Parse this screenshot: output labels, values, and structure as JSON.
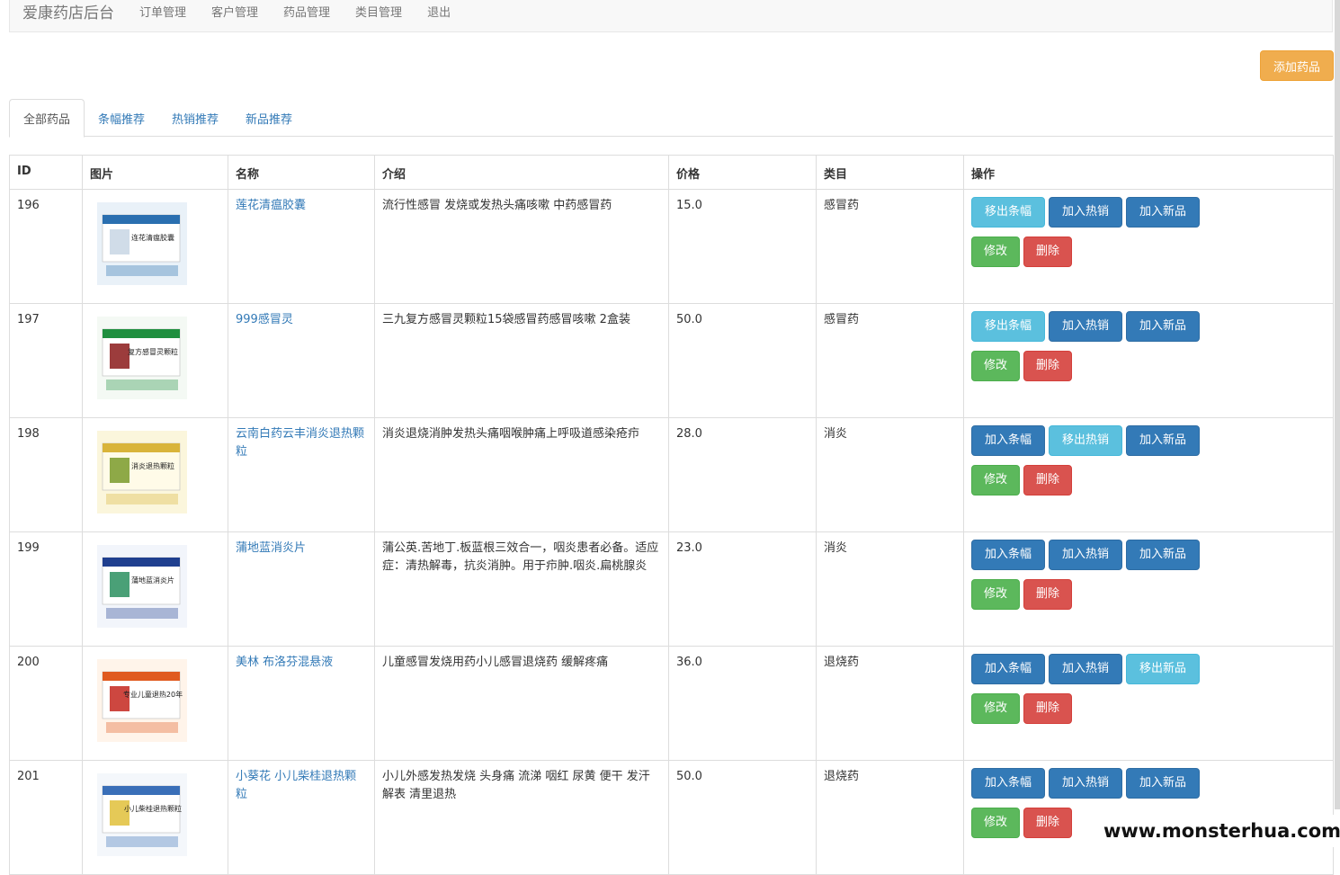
{
  "navbar": {
    "brand": "爱康药店后台",
    "links": [
      "订单管理",
      "客户管理",
      "药品管理",
      "类目管理",
      "退出"
    ]
  },
  "add_button": "添加药品",
  "tabs": [
    "全部药品",
    "条幅推荐",
    "热销推荐",
    "新品推荐"
  ],
  "table": {
    "headers": [
      "ID",
      "图片",
      "名称",
      "介绍",
      "价格",
      "类目",
      "操作"
    ],
    "rows": [
      {
        "id": "196",
        "name": "莲花清瘟胶囊",
        "desc": "流行性感冒 发烧或发热头痛咳嗽 中药感冒药",
        "price": "15.0",
        "category": "感冒药",
        "ops": [
          "移出条幅",
          "加入热销",
          "加入新品",
          "修改",
          "删除"
        ],
        "op_styles": [
          "info",
          "primary",
          "primary"
        ]
      },
      {
        "id": "197",
        "name": "999感冒灵",
        "desc": "三九复方感冒灵颗粒15袋感冒药感冒咳嗽 2盒装",
        "price": "50.0",
        "category": "感冒药",
        "ops": [
          "移出条幅",
          "加入热销",
          "加入新品",
          "修改",
          "删除"
        ],
        "op_styles": [
          "info",
          "primary",
          "primary"
        ]
      },
      {
        "id": "198",
        "name": "云南白药云丰消炎退热颗粒",
        "desc": "消炎退烧消肿发热头痛咽喉肿痛上呼吸道感染疮疖",
        "price": "28.0",
        "category": "消炎",
        "ops": [
          "加入条幅",
          "移出热销",
          "加入新品",
          "修改",
          "删除"
        ],
        "op_styles": [
          "primary",
          "info",
          "primary"
        ]
      },
      {
        "id": "199",
        "name": "蒲地蓝消炎片",
        "desc": "蒲公英.苦地丁.板蓝根三效合一，咽炎患者必备。适应症：清热解毒，抗炎消肿。用于疖肿.咽炎.扁桃腺炎",
        "price": "23.0",
        "category": "消炎",
        "ops": [
          "加入条幅",
          "加入热销",
          "加入新品",
          "修改",
          "删除"
        ],
        "op_styles": [
          "primary",
          "primary",
          "primary"
        ]
      },
      {
        "id": "200",
        "name": "美林 布洛芬混悬液",
        "desc": "儿童感冒发烧用药小儿感冒退烧药 缓解疼痛",
        "price": "36.0",
        "category": "退烧药",
        "ops": [
          "加入条幅",
          "加入热销",
          "移出新品",
          "修改",
          "删除"
        ],
        "op_styles": [
          "primary",
          "primary",
          "info"
        ]
      },
      {
        "id": "201",
        "name": "小葵花 小儿柴桂退热颗粒",
        "desc": "小儿外感发热发烧 头身痛 流涕 咽红 尿黄 便干 发汗解表 清里退热",
        "price": "50.0",
        "category": "退烧药",
        "ops": [
          "加入条幅",
          "加入热销",
          "加入新品",
          "修改",
          "删除"
        ],
        "op_styles": [
          "primary",
          "primary",
          "primary"
        ]
      }
    ]
  },
  "thumb_labels": [
    "连花清瘟胶囊",
    "复方感冒灵颗粒",
    "消炎退热颗粒",
    "蒲地蓝消炎片",
    "专业儿童退热20年",
    "小儿柴桂退热颗粒"
  ],
  "watermark": "www.monsterhua.com"
}
